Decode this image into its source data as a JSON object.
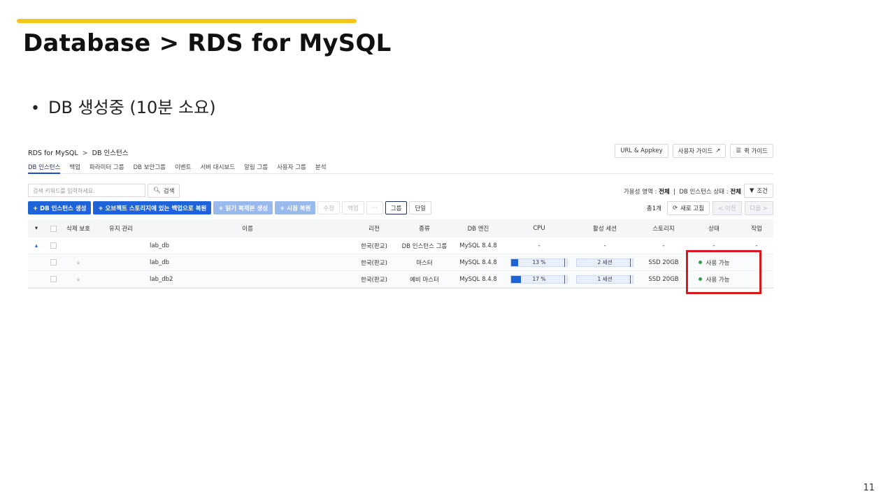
{
  "slide": {
    "title": "Database > RDS for MySQL",
    "bullet": "DB 생성중 (10분 소요)",
    "page_number": "11"
  },
  "colors": {
    "accent": "#f5c518",
    "primary": "#1f63d8",
    "highlight": "#d7191c",
    "status_ok": "#2f9e44"
  },
  "console": {
    "breadcrumb": {
      "root": "RDS for MySQL",
      "separator": ">",
      "current": "DB 인스턴스"
    },
    "top_buttons": {
      "url_appkey": "URL & Appkey",
      "user_guide": "사용자 가이드",
      "quick_guide": "퀵 가이드"
    },
    "tabs": [
      "DB 인스턴스",
      "백업",
      "파라미터 그룹",
      "DB 보안그룹",
      "이벤트",
      "서버 대시보드",
      "알림 그룹",
      "사용자 그룹",
      "분석"
    ],
    "search": {
      "placeholder": "검색 키워드를 입력하세요.",
      "button": "검색"
    },
    "filter": {
      "zone_label": "가용성 영역 :",
      "zone_value": "전체",
      "state_label": "DB 인스턴스 상태 :",
      "state_value": "전체",
      "button": "조건"
    },
    "actions": {
      "create": "+ DB 인스턴스 생성",
      "restore_obj": "+ 오브젝트 스토리지에 있는 백업으로 복원",
      "read_replica": "+ 읽기 복제본 생성",
      "pitr": "+ 시점 복원",
      "modify": "수정",
      "backup": "백업",
      "more": "···",
      "group": "그룹",
      "single": "단일"
    },
    "pager": {
      "count": "총1개",
      "refresh": "새로 고침",
      "prev": "< 이전",
      "next": "다음 >"
    },
    "columns": [
      "삭제 보호",
      "유지 관리",
      "이름",
      "리전",
      "종류",
      "DB 엔진",
      "CPU",
      "활성 세션",
      "스토리지",
      "상태",
      "작업"
    ],
    "group_row": {
      "name": "lab_db",
      "region": "한국(판교)",
      "type": "DB 인스턴스 그룹",
      "engine": "MySQL 8.4.8",
      "cpu": "-",
      "sessions": "-",
      "storage": "-",
      "status": "-",
      "job": "-"
    },
    "rows": [
      {
        "name": "lab_db",
        "region": "한국(판교)",
        "type": "마스터",
        "engine": "MySQL 8.4.8",
        "cpu_label": "13 %",
        "cpu_pct": 13,
        "sessions": "2 세션",
        "storage": "SSD 20GB",
        "status": "사용 가능"
      },
      {
        "name": "lab_db2",
        "region": "한국(판교)",
        "type": "예비 마스터",
        "engine": "MySQL 8.4.8",
        "cpu_label": "17 %",
        "cpu_pct": 17,
        "sessions": "1 세션",
        "storage": "SSD 20GB",
        "status": "사용 가능"
      }
    ]
  }
}
